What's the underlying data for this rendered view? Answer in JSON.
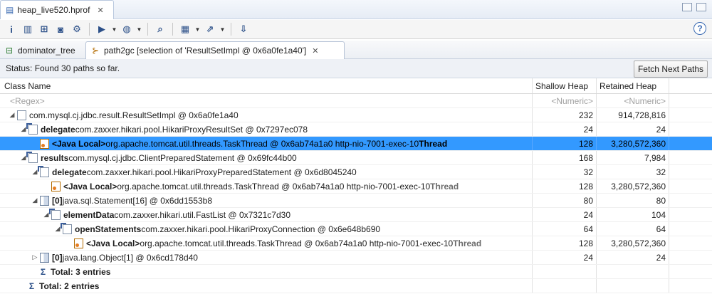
{
  "editor": {
    "tab_title": "heap_live520.hprof",
    "tab_close": "✕"
  },
  "toolbar": {
    "help": "?"
  },
  "view_tabs": [
    {
      "label": "dominator_tree"
    },
    {
      "label": "path2gc  [selection of 'ResultSetImpl @ 0x6a0fe1a40']",
      "close": "✕"
    }
  ],
  "status": {
    "text": "Status:  Found 30 paths so far.",
    "fetch_button": "Fetch Next Paths"
  },
  "columns": {
    "name": "Class Name",
    "shallow": "Shallow Heap",
    "retained": "Retained Heap"
  },
  "filter": {
    "name": "<Regex>",
    "shallow": "<Numeric>",
    "retained": "<Numeric>"
  },
  "rows": [
    {
      "twisty": "◢",
      "bold": "",
      "rest": "com.mysql.cj.jdbc.result.ResultSetImpl @ 0x6a0fe1a40",
      "thread": "",
      "shallow": "232",
      "retained": "914,728,816"
    },
    {
      "twisty": "◢",
      "bold": "delegate",
      "rest": " com.zaxxer.hikari.pool.HikariProxyResultSet @ 0x7297ec078",
      "thread": "",
      "shallow": "24",
      "retained": "24"
    },
    {
      "twisty": "",
      "bold": "<Java Local>",
      "rest": " org.apache.tomcat.util.threads.TaskThread @ 0x6ab74a1a0  http-nio-7001-exec-10 ",
      "thread": "Thread",
      "shallow": "128",
      "retained": "3,280,572,360"
    },
    {
      "twisty": "◢",
      "bold": "results",
      "rest": " com.mysql.cj.jdbc.ClientPreparedStatement @ 0x69fc44b00",
      "thread": "",
      "shallow": "168",
      "retained": "7,984"
    },
    {
      "twisty": "◢",
      "bold": "delegate",
      "rest": " com.zaxxer.hikari.pool.HikariProxyPreparedStatement @ 0x6d8045240",
      "thread": "",
      "shallow": "32",
      "retained": "32"
    },
    {
      "twisty": "",
      "bold": "<Java Local>",
      "rest": " org.apache.tomcat.util.threads.TaskThread @ 0x6ab74a1a0  http-nio-7001-exec-10 ",
      "thread": "Thread",
      "shallow": "128",
      "retained": "3,280,572,360"
    },
    {
      "twisty": "◢",
      "bold": "[0]",
      "rest": " java.sql.Statement[16] @ 0x6dd1553b8",
      "thread": "",
      "shallow": "80",
      "retained": "80"
    },
    {
      "twisty": "◢",
      "bold": "elementData",
      "rest": " com.zaxxer.hikari.util.FastList @ 0x7321c7d30",
      "thread": "",
      "shallow": "24",
      "retained": "104"
    },
    {
      "twisty": "◢",
      "bold": "openStatements",
      "rest": " com.zaxxer.hikari.pool.HikariProxyConnection @ 0x6e648b690",
      "thread": "",
      "shallow": "64",
      "retained": "64"
    },
    {
      "twisty": "",
      "bold": "<Java Local>",
      "rest": " org.apache.tomcat.util.threads.TaskThread @ 0x6ab74a1a0  http-nio-7001-exec-10 ",
      "thread": "Thread",
      "shallow": "128",
      "retained": "3,280,572,360"
    },
    {
      "twisty": "▷",
      "bold": "[0]",
      "rest": " java.lang.Object[1] @ 0x6cd178d40",
      "thread": "",
      "shallow": "24",
      "retained": "24"
    },
    {
      "twisty": "",
      "bold": "Total: 3 entries",
      "rest": "",
      "thread": "",
      "shallow": "",
      "retained": ""
    },
    {
      "twisty": "",
      "bold": "Total: 2 entries",
      "rest": "",
      "thread": "",
      "shallow": "",
      "retained": ""
    }
  ]
}
